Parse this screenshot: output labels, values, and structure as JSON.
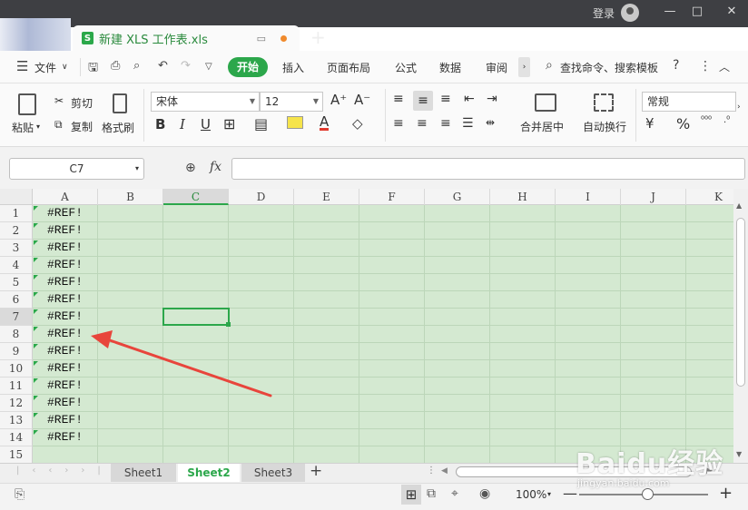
{
  "titlebar": {
    "doc_tab_title": "新建 XLS 工作表.xls",
    "login": "登录",
    "new_tab": "+"
  },
  "menu": {
    "file": "文件",
    "tabs": [
      "开始",
      "插入",
      "页面布局",
      "公式",
      "数据",
      "审阅"
    ],
    "search": "查找命令、搜索模板",
    "help": "?"
  },
  "ribbon": {
    "paste": "粘贴",
    "cut": "剪切",
    "copy": "复制",
    "format_painter": "格式刷",
    "font_name": "宋体",
    "font_size": "12",
    "merge_center": "合并居中",
    "wrap_text": "自动换行",
    "number_format": "常规",
    "percent": "%"
  },
  "formula_bar": {
    "name_box": "C7",
    "fx": "fx",
    "formula": ""
  },
  "grid": {
    "columns": [
      "A",
      "B",
      "C",
      "D",
      "E",
      "F",
      "G",
      "H",
      "I",
      "J",
      "K"
    ],
    "rows": [
      "1",
      "2",
      "3",
      "4",
      "5",
      "6",
      "7",
      "8",
      "9",
      "10",
      "11",
      "12",
      "13",
      "14",
      "15"
    ],
    "cells_A": [
      "#REF!",
      "#REF!",
      "#REF!",
      "#REF!",
      "#REF!",
      "#REF!",
      "#REF!",
      "#REF!",
      "#REF!",
      "#REF!",
      "#REF!",
      "#REF!",
      "#REF!",
      "#REF!"
    ],
    "active_column": "C",
    "active_row": "7"
  },
  "sheets": [
    "Sheet1",
    "Sheet2",
    "Sheet3"
  ],
  "active_sheet": "Sheet2",
  "status": {
    "zoom": "100%"
  },
  "watermark": {
    "main": "Baidu经验",
    "sub": "jingyan.baidu.com"
  },
  "colors": {
    "accent": "#2ca74b",
    "grid_bg": "#d4e9d1",
    "arrow": "#e8453c"
  }
}
